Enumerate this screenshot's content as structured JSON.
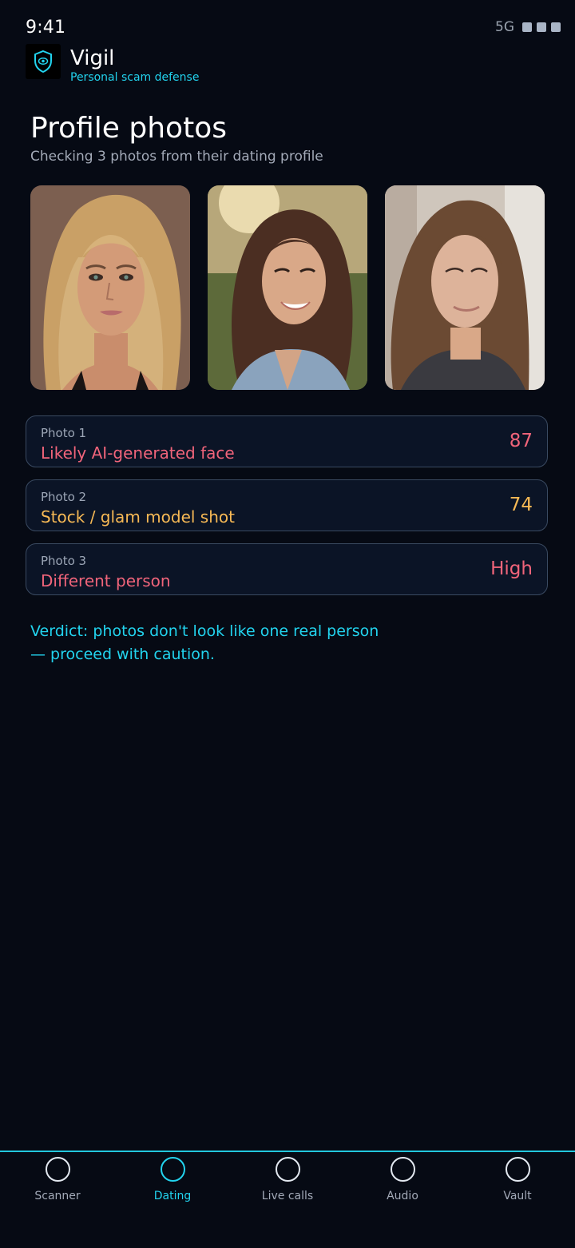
{
  "status_bar": {
    "time": "9:41",
    "network": "5G"
  },
  "app": {
    "name": "Vigil",
    "tagline": "Personal scam defense",
    "logo_icon": "shield-eye-icon"
  },
  "page": {
    "title": "Profile photos",
    "subtitle": "Checking 3 photos from their dating profile"
  },
  "photos": [
    {
      "alt": "Photo 1"
    },
    {
      "alt": "Photo 2"
    },
    {
      "alt": "Photo 3"
    }
  ],
  "results": [
    {
      "label": "Photo 1",
      "finding": "Likely AI-generated face",
      "score": "87",
      "color": "#f0647a"
    },
    {
      "label": "Photo 2",
      "finding": "Stock / glam model shot",
      "score": "74",
      "color": "#f7b955"
    },
    {
      "label": "Photo 3",
      "finding": "Different person",
      "score": "High",
      "color": "#f0647a"
    }
  ],
  "verdict": "Verdict: photos don't look like one real person — proceed with caution.",
  "nav": {
    "items": [
      {
        "label": "Scanner",
        "icon": "circle-icon",
        "active": false
      },
      {
        "label": "Dating",
        "icon": "circle-icon",
        "active": true
      },
      {
        "label": "Live calls",
        "icon": "circle-icon",
        "active": false
      },
      {
        "label": "Audio",
        "icon": "circle-icon",
        "active": false
      },
      {
        "label": "Vault",
        "icon": "circle-icon",
        "active": false
      }
    ]
  },
  "colors": {
    "accent": "#22d3ee",
    "background": "#060a14",
    "danger": "#f0647a",
    "warning": "#f7b955"
  }
}
